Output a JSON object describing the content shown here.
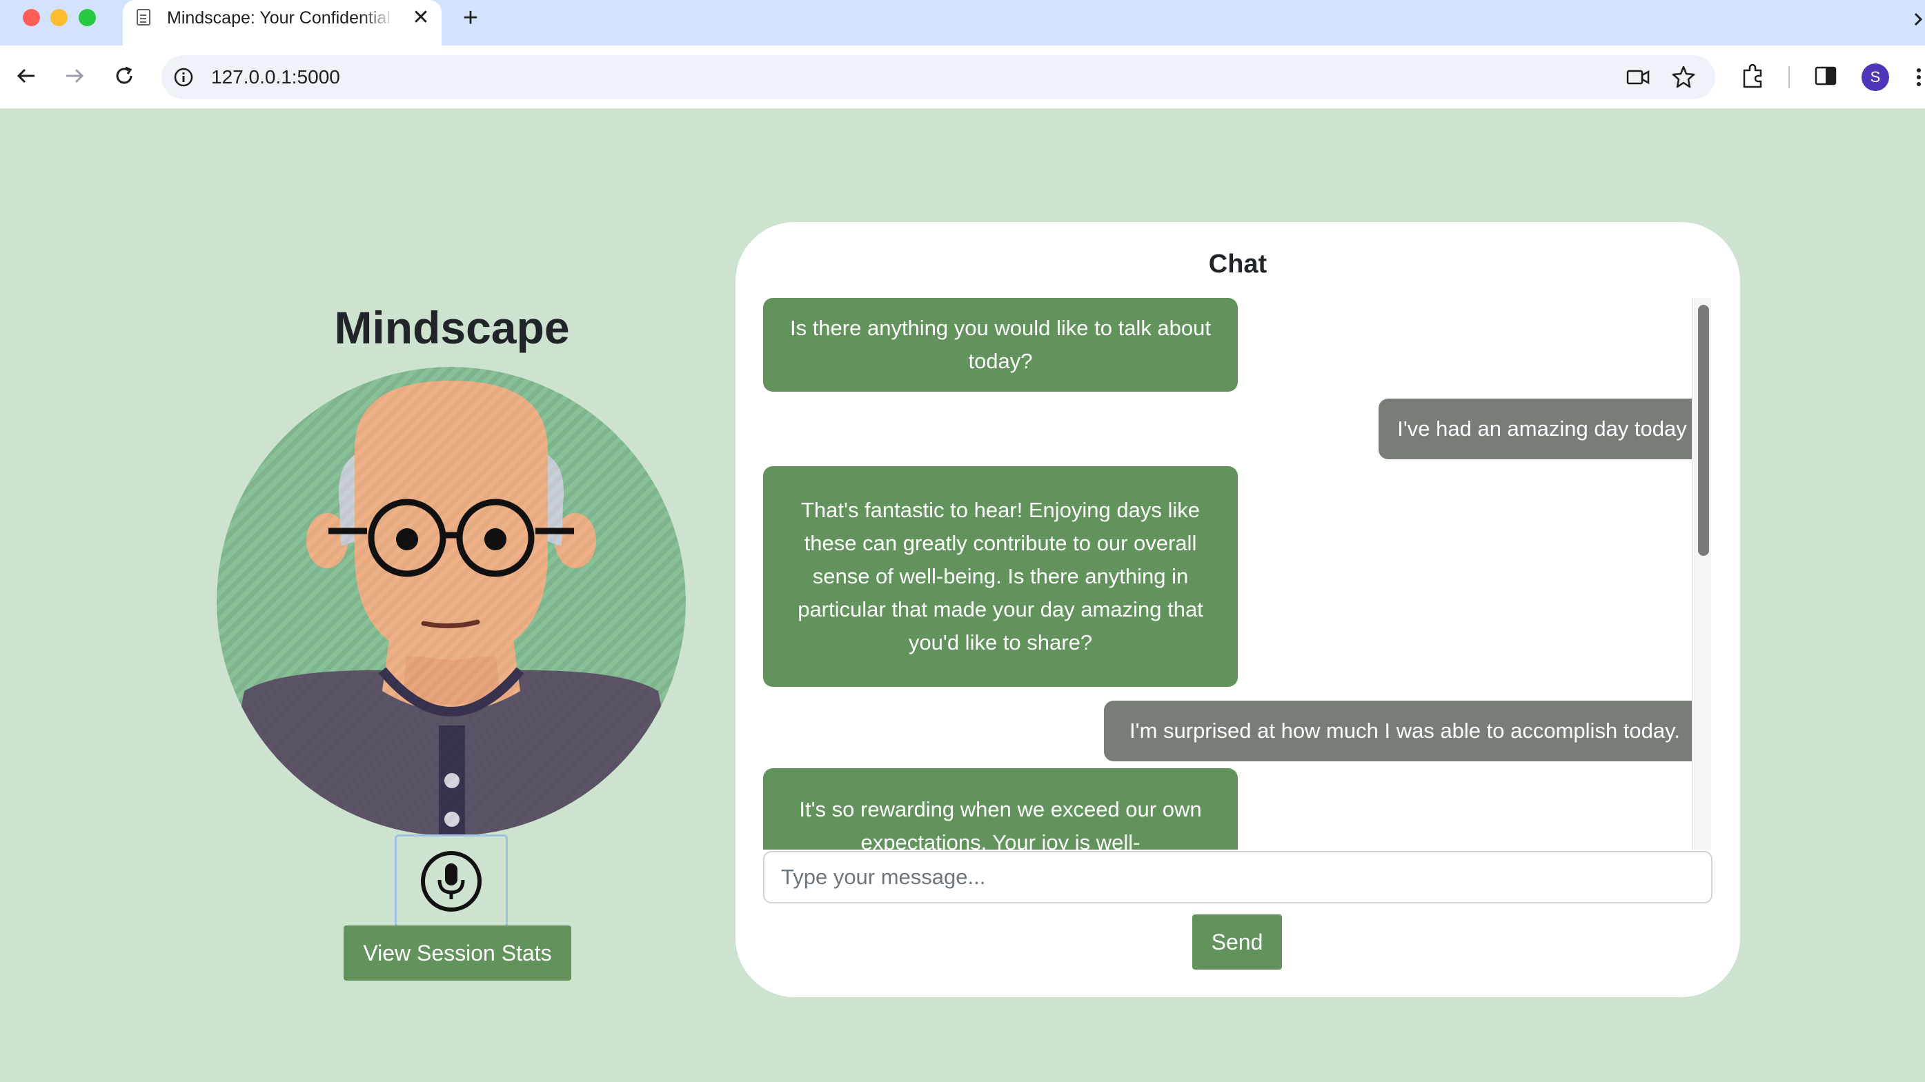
{
  "browser": {
    "tab_title": "Mindscape: Your Confidential",
    "tab_close": "✕",
    "new_tab": "+",
    "url": "127.0.0.1:5000",
    "profile_initial": "S"
  },
  "app": {
    "title": "Mindscape",
    "mic_icon": "microphone-icon",
    "stats_button": "View Session Stats",
    "theme": {
      "background": "#cde3d0",
      "accent": "#63935c",
      "user_bubble": "#777e78"
    }
  },
  "chat": {
    "title": "Chat",
    "messages": [
      {
        "role": "bot",
        "text": "Is there anything you would like to talk about today?"
      },
      {
        "role": "user",
        "text": "I've had an amazing day today"
      },
      {
        "role": "bot",
        "text": "That's fantastic to hear! Enjoying days like these can greatly contribute to our overall sense of well-being. Is there anything in particular that made your day amazing that you'd like to share?"
      },
      {
        "role": "user",
        "text": "I'm surprised at how much I was able to accomplish today."
      },
      {
        "role": "bot",
        "text": "It's so rewarding when we exceed our own expectations. Your joy is well-"
      }
    ],
    "input_placeholder": "Type your message...",
    "send_button": "Send"
  }
}
